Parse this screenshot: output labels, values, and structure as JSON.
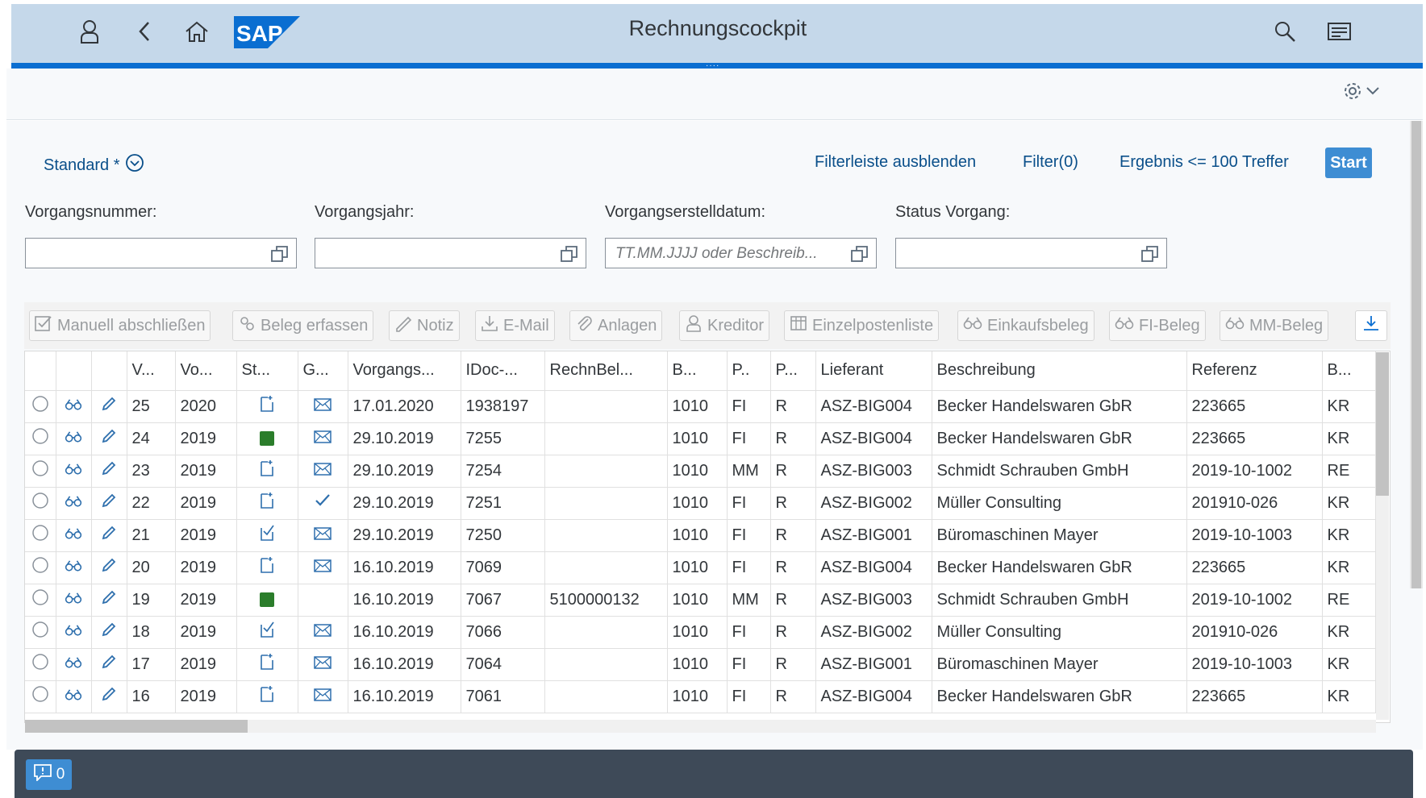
{
  "shell": {
    "title": "Rechnungscockpit",
    "logo_text": "SAP",
    "icons": [
      "user-icon",
      "back-icon",
      "home-icon",
      "search-icon",
      "menu-icon"
    ]
  },
  "filterbar": {
    "variant": "Standard *",
    "hide_link": "Filterleiste ausblenden",
    "filter_link": "Filter(0)",
    "result_link": "Ergebnis <= 100 Treffer",
    "start": "Start",
    "fields": [
      {
        "label": "Vorgangsnummer:",
        "placeholder": ""
      },
      {
        "label": "Vorgangsjahr:",
        "placeholder": ""
      },
      {
        "label": "Vorgangserstelldatum:",
        "placeholder": "TT.MM.JJJJ oder Beschreib..."
      },
      {
        "label": "Status Vorgang:",
        "placeholder": ""
      }
    ]
  },
  "toolbar": {
    "buttons": [
      "Manuell abschließen",
      "Beleg erfassen",
      "Notiz",
      "E-Mail",
      "Anlagen",
      "Kreditor",
      "Einzelpostenliste",
      "Einkaufsbeleg",
      "FI-Beleg",
      "MM-Beleg"
    ]
  },
  "table": {
    "headers": [
      "",
      "",
      "",
      "V...",
      "Vo...",
      "St...",
      "G...",
      "Vorgangs...",
      "IDoc-...",
      "RechnBel...",
      "B...",
      "P..",
      "P...",
      "Lieferant",
      "Beschreibung",
      "Referenz",
      "B..."
    ],
    "rows": [
      {
        "v": "25",
        "year": "2020",
        "status": "doc",
        "g": "mail",
        "date": "17.01.2020",
        "idoc": "1938197",
        "rech": "",
        "b": "1010",
        "p1": "FI",
        "p2": "R",
        "lief": "ASZ-BIG004",
        "desc": "Becker Handelswaren GbR",
        "ref": "223665",
        "b2": "KR"
      },
      {
        "v": "24",
        "year": "2019",
        "status": "green",
        "g": "mail",
        "date": "29.10.2019",
        "idoc": "7255",
        "rech": "",
        "b": "1010",
        "p1": "FI",
        "p2": "R",
        "lief": "ASZ-BIG004",
        "desc": "Becker Handelswaren GbR",
        "ref": "223665",
        "b2": "KR"
      },
      {
        "v": "23",
        "year": "2019",
        "status": "doc",
        "g": "mail",
        "date": "29.10.2019",
        "idoc": "7254",
        "rech": "",
        "b": "1010",
        "p1": "MM",
        "p2": "R",
        "lief": "ASZ-BIG003",
        "desc": "Schmidt Schrauben GmbH",
        "ref": "2019-10-1002",
        "b2": "RE"
      },
      {
        "v": "22",
        "year": "2019",
        "status": "doc",
        "g": "check",
        "date": "29.10.2019",
        "idoc": "7251",
        "rech": "",
        "b": "1010",
        "p1": "FI",
        "p2": "R",
        "lief": "ASZ-BIG002",
        "desc": "Müller Consulting",
        "ref": "201910-026",
        "b2": "KR"
      },
      {
        "v": "21",
        "year": "2019",
        "status": "checkdoc",
        "g": "mail",
        "date": "29.10.2019",
        "idoc": "7250",
        "rech": "",
        "b": "1010",
        "p1": "FI",
        "p2": "R",
        "lief": "ASZ-BIG001",
        "desc": "Büromaschinen Mayer",
        "ref": "2019-10-1003",
        "b2": "KR"
      },
      {
        "v": "20",
        "year": "2019",
        "status": "doc",
        "g": "mail",
        "date": "16.10.2019",
        "idoc": "7069",
        "rech": "",
        "b": "1010",
        "p1": "FI",
        "p2": "R",
        "lief": "ASZ-BIG004",
        "desc": "Becker Handelswaren GbR",
        "ref": "223665",
        "b2": "KR"
      },
      {
        "v": "19",
        "year": "2019",
        "status": "green",
        "g": "",
        "date": "16.10.2019",
        "idoc": "7067",
        "rech": "5100000132",
        "b": "1010",
        "p1": "MM",
        "p2": "R",
        "lief": "ASZ-BIG003",
        "desc": "Schmidt Schrauben GmbH",
        "ref": "2019-10-1002",
        "b2": "RE"
      },
      {
        "v": "18",
        "year": "2019",
        "status": "checkdoc",
        "g": "mail",
        "date": "16.10.2019",
        "idoc": "7066",
        "rech": "",
        "b": "1010",
        "p1": "FI",
        "p2": "R",
        "lief": "ASZ-BIG002",
        "desc": "Müller Consulting",
        "ref": "201910-026",
        "b2": "KR"
      },
      {
        "v": "17",
        "year": "2019",
        "status": "doc",
        "g": "mail",
        "date": "16.10.2019",
        "idoc": "7064",
        "rech": "",
        "b": "1010",
        "p1": "FI",
        "p2": "R",
        "lief": "ASZ-BIG001",
        "desc": "Büromaschinen Mayer",
        "ref": "2019-10-1003",
        "b2": "KR"
      },
      {
        "v": "16",
        "year": "2019",
        "status": "doc",
        "g": "mail",
        "date": "16.10.2019",
        "idoc": "7061",
        "rech": "",
        "b": "1010",
        "p1": "FI",
        "p2": "R",
        "lief": "ASZ-BIG004",
        "desc": "Becker Handelswaren GbR",
        "ref": "223665",
        "b2": "KR"
      }
    ]
  },
  "footer": {
    "message_count": "0"
  },
  "colors": {
    "shell": "#c5d8ea",
    "accent": "#0a6ed1",
    "button": "#3e8dd3",
    "footer": "#3e4a58",
    "status_green": "#2b7d2b"
  }
}
